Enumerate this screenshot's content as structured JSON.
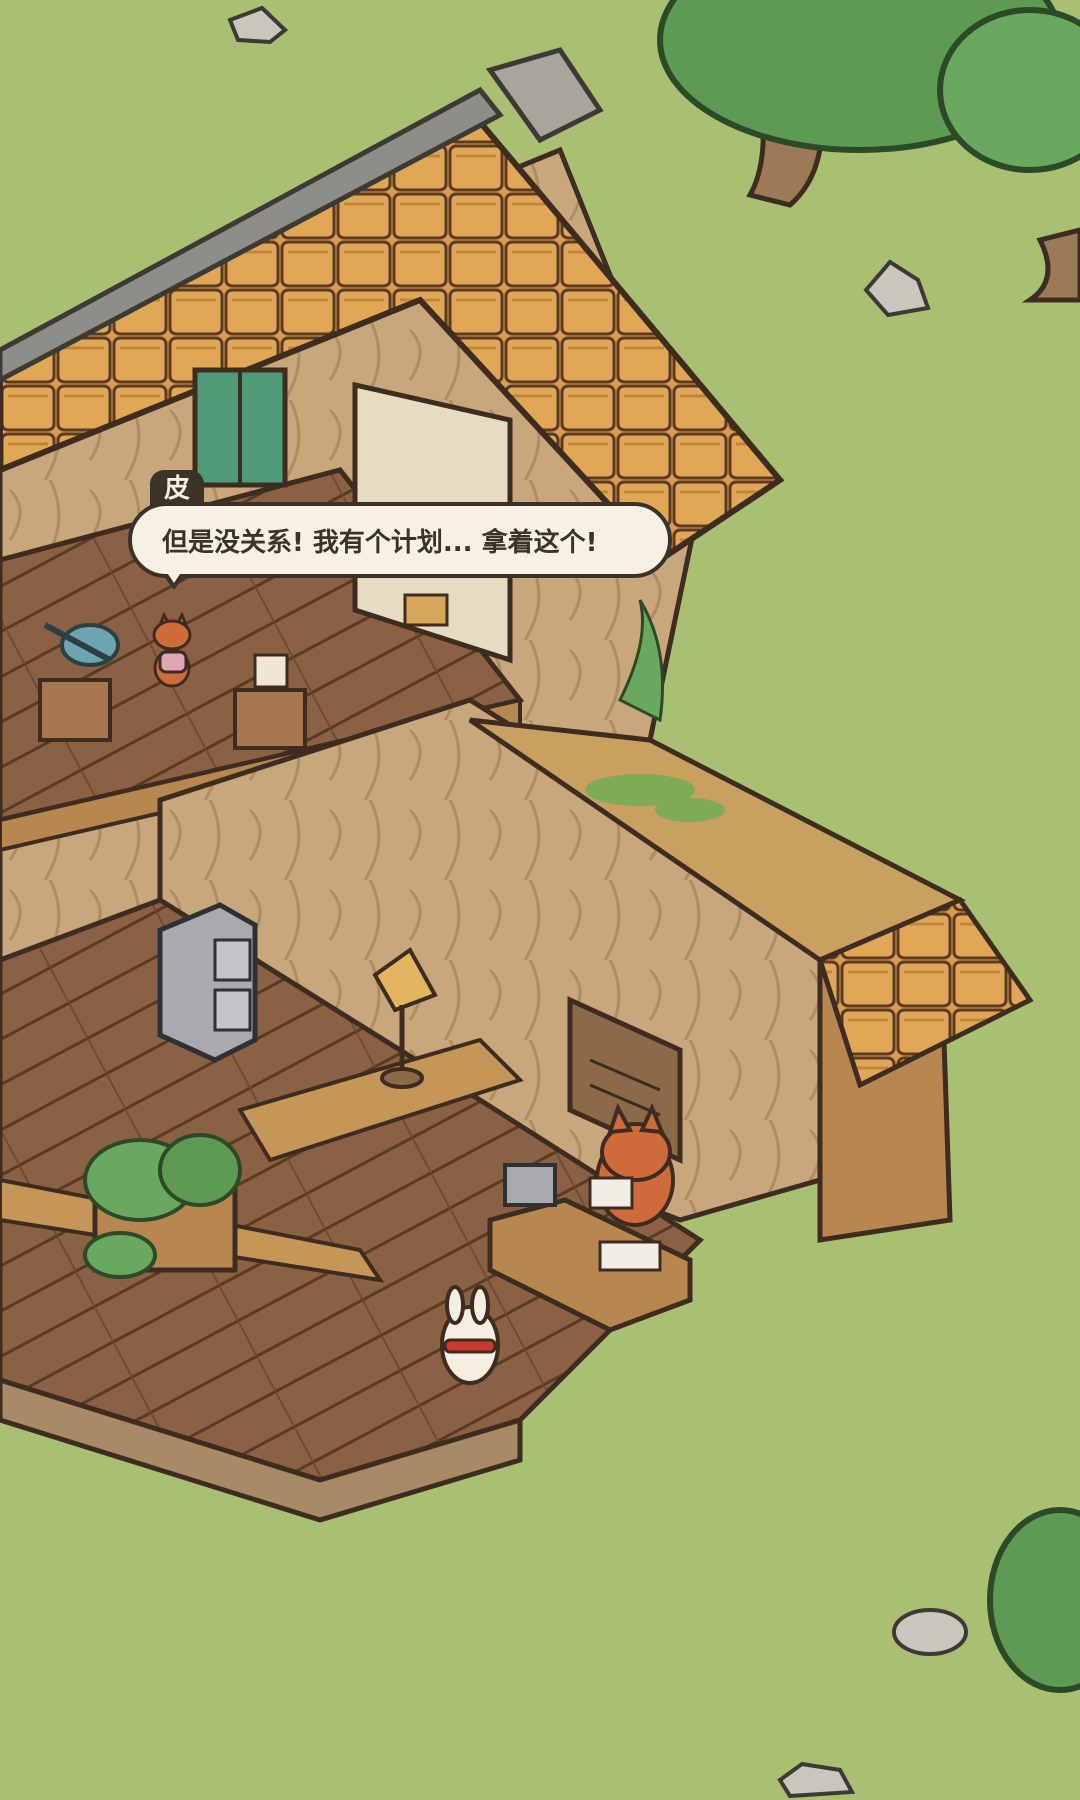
{
  "dialogue": {
    "speaker": "皮皮",
    "text": "但是没关系! 我有个计划... 拿着这个!"
  },
  "characters": {
    "speaker_fox": "small-fox-upstairs",
    "reader_fox": "fox-reading-at-desk",
    "player": "white-rabbit-red-scarf"
  },
  "colors": {
    "grass": "#a9bf72",
    "roof_tile": "#d99a4c",
    "wood_floor": "#8a6144",
    "wall": "#c9a77d",
    "bubble_bg": "#f6f1e3",
    "bubble_text": "#3b3229"
  }
}
